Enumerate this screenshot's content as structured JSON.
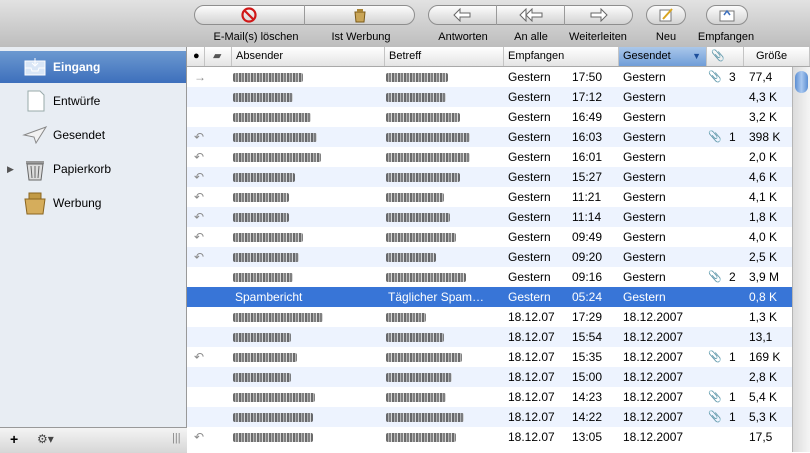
{
  "toolbar": {
    "delete_label": "E-Mail(s) löschen",
    "junk_label": "Ist Werbung",
    "reply_label": "Antworten",
    "reply_all_label": "An alle",
    "forward_label": "Weiterleiten",
    "new_label": "Neu",
    "get_mail_label": "Empfangen"
  },
  "sidebar": {
    "items": [
      {
        "label": "Eingang",
        "icon": "inbox-icon"
      },
      {
        "label": "Entwürfe",
        "icon": "drafts-icon"
      },
      {
        "label": "Gesendet",
        "icon": "sent-icon"
      },
      {
        "label": "Papierkorb",
        "icon": "trash-icon"
      },
      {
        "label": "Werbung",
        "icon": "junk-icon"
      }
    ],
    "add_label": "+",
    "action_label": "⚙▾"
  },
  "columns": {
    "from": "Absender",
    "subject": "Betreff",
    "received": "Empfangen",
    "sent": "Gesendet",
    "size": "Größe"
  },
  "messages": [
    {
      "status": "→",
      "recv_day": "Gestern",
      "recv_time": "17:50",
      "sent": "Gestern",
      "attach": "📎",
      "attach_count": "3",
      "size": "77,4"
    },
    {
      "status": "",
      "recv_day": "Gestern",
      "recv_time": "17:12",
      "sent": "Gestern",
      "attach": "",
      "attach_count": "",
      "size": "4,3 K"
    },
    {
      "status": "",
      "recv_day": "Gestern",
      "recv_time": "16:49",
      "sent": "Gestern",
      "attach": "",
      "attach_count": "",
      "size": "3,2 K"
    },
    {
      "status": "↶",
      "recv_day": "Gestern",
      "recv_time": "16:03",
      "sent": "Gestern",
      "attach": "📎",
      "attach_count": "1",
      "size": "398 K"
    },
    {
      "status": "↶",
      "recv_day": "Gestern",
      "recv_time": "16:01",
      "sent": "Gestern",
      "attach": "",
      "attach_count": "",
      "size": "2,0 K"
    },
    {
      "status": "↶",
      "recv_day": "Gestern",
      "recv_time": "15:27",
      "sent": "Gestern",
      "attach": "",
      "attach_count": "",
      "size": "4,6 K"
    },
    {
      "status": "↶",
      "recv_day": "Gestern",
      "recv_time": "11:21",
      "sent": "Gestern",
      "attach": "",
      "attach_count": "",
      "size": "4,1 K"
    },
    {
      "status": "↶",
      "recv_day": "Gestern",
      "recv_time": "11:14",
      "sent": "Gestern",
      "attach": "",
      "attach_count": "",
      "size": "1,8 K"
    },
    {
      "status": "↶",
      "recv_day": "Gestern",
      "recv_time": "09:49",
      "sent": "Gestern",
      "attach": "",
      "attach_count": "",
      "size": "4,0 K"
    },
    {
      "status": "↶",
      "recv_day": "Gestern",
      "recv_time": "09:20",
      "sent": "Gestern",
      "attach": "",
      "attach_count": "",
      "size": "2,5 K"
    },
    {
      "status": "",
      "recv_day": "Gestern",
      "recv_time": "09:16",
      "sent": "Gestern",
      "attach": "📎",
      "attach_count": "2",
      "size": "3,9 M"
    },
    {
      "status": "",
      "from": "Spambericht",
      "subject": "Täglicher Spam…",
      "recv_day": "Gestern",
      "recv_time": "05:24",
      "sent": "Gestern",
      "attach": "",
      "attach_count": "",
      "size": "0,8 K"
    },
    {
      "status": "",
      "recv_day": "18.12.07",
      "recv_time": "17:29",
      "sent": "18.12.2007",
      "attach": "",
      "attach_count": "",
      "size": "1,3 K"
    },
    {
      "status": "",
      "recv_day": "18.12.07",
      "recv_time": "15:54",
      "sent": "18.12.2007",
      "attach": "",
      "attach_count": "",
      "size": "13,1"
    },
    {
      "status": "↶",
      "recv_day": "18.12.07",
      "recv_time": "15:35",
      "sent": "18.12.2007",
      "attach": "📎",
      "attach_count": "1",
      "size": "169 K"
    },
    {
      "status": "",
      "recv_day": "18.12.07",
      "recv_time": "15:00",
      "sent": "18.12.2007",
      "attach": "",
      "attach_count": "",
      "size": "2,8 K"
    },
    {
      "status": "",
      "recv_day": "18.12.07",
      "recv_time": "14:23",
      "sent": "18.12.2007",
      "attach": "📎",
      "attach_count": "1",
      "size": "5,4 K"
    },
    {
      "status": "",
      "recv_day": "18.12.07",
      "recv_time": "14:22",
      "sent": "18.12.2007",
      "attach": "📎",
      "attach_count": "1",
      "size": "5,3 K"
    },
    {
      "status": "↶",
      "recv_day": "18.12.07",
      "recv_time": "13:05",
      "sent": "18.12.2007",
      "attach": "",
      "attach_count": "",
      "size": "17,5"
    }
  ],
  "selected_row_index": 11
}
